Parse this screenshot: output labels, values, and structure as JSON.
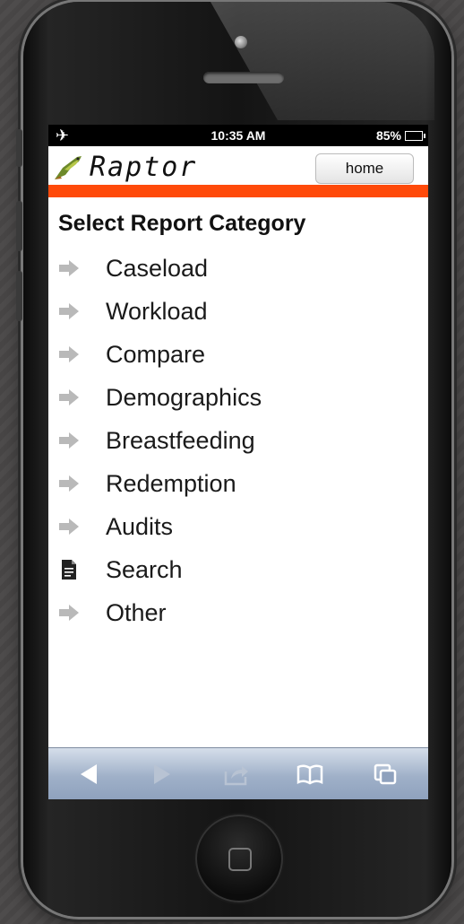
{
  "status_bar": {
    "airplane_icon": "airplane-icon",
    "time": "10:35 AM",
    "battery": "85%",
    "battery_level": 0.85
  },
  "header": {
    "logo_text": "Raptor",
    "home_button_label": "home",
    "accent_color": "#ff4a0a"
  },
  "page_title": "Select Report Category",
  "menu": {
    "items": [
      {
        "label": "Caseload",
        "icon": "arrow-right-icon"
      },
      {
        "label": "Workload",
        "icon": "arrow-right-icon"
      },
      {
        "label": "Compare",
        "icon": "arrow-right-icon"
      },
      {
        "label": "Demographics",
        "icon": "arrow-right-icon"
      },
      {
        "label": "Breastfeeding",
        "icon": "arrow-right-icon"
      },
      {
        "label": "Redemption",
        "icon": "arrow-right-icon"
      },
      {
        "label": "Audits",
        "icon": "arrow-right-icon"
      },
      {
        "label": "Search",
        "icon": "document-icon"
      },
      {
        "label": "Other",
        "icon": "arrow-right-icon"
      }
    ]
  },
  "toolbar": {
    "items": [
      "back-icon",
      "forward-icon",
      "share-icon",
      "bookmarks-icon",
      "tabs-icon"
    ]
  }
}
